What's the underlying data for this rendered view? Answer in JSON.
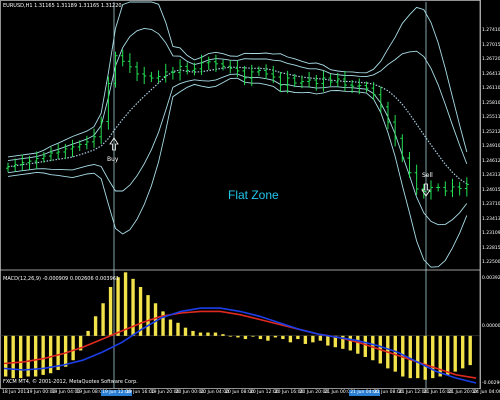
{
  "chart_header": "EURUSD,H1  1.31165 1.31189 1.31165 1.31220",
  "indicator_header": "MACD(12,26,9) -0.000909 0.002606 0.003961",
  "copyright": "FXCM MT4, © 2001-2012, MetaQuotes Software Corp.",
  "annotations": {
    "zone": "Flat Zone",
    "buy": "Buy",
    "sell": "Sell"
  },
  "price_axis": [
    "1.27410",
    "1.27015",
    "1.26720",
    "1.26413",
    "1.26110",
    "1.25810",
    "1.25511",
    "1.25212",
    "1.24910",
    "1.24612",
    "1.24313",
    "1.24015",
    "1.23710",
    "1.23413",
    "1.23109",
    "1.22815",
    "1.22500"
  ],
  "macd_axis": [
    "0.003920",
    "0.000000",
    "-0.002960"
  ],
  "time_axis": [
    {
      "t": "18 Jun 2013",
      "hl": false
    },
    {
      "t": "19 Jun 00:00",
      "hl": false
    },
    {
      "t": "19 Jun 04:00",
      "hl": false
    },
    {
      "t": "19 Jun 08:00",
      "hl": false
    },
    {
      "t": "19 Jun 12:00",
      "hl": true
    },
    {
      "t": "19 Jun 16:00",
      "hl": false
    },
    {
      "t": "19 Jun 20:00",
      "hl": false
    },
    {
      "t": "20 Jun 00:00",
      "hl": false
    },
    {
      "t": "20 Jun 04:00",
      "hl": false
    },
    {
      "t": "20 Jun 08:00",
      "hl": false
    },
    {
      "t": "20 Jun 12:00",
      "hl": false
    },
    {
      "t": "20 Jun 16:00",
      "hl": false
    },
    {
      "t": "20 Jun 20:00",
      "hl": false
    },
    {
      "t": "21 Jun 00:00",
      "hl": false
    },
    {
      "t": "21 Jun 04:00",
      "hl": true
    },
    {
      "t": "21 Jun 08:00",
      "hl": false
    },
    {
      "t": "21 Jun 12:00",
      "hl": false
    },
    {
      "t": "21 Jun 16:00",
      "hl": false
    },
    {
      "t": "21 Jun 20:00",
      "hl": false
    },
    {
      "t": "24 Jun 04:00",
      "hl": false
    }
  ],
  "colors": {
    "background": "#000000",
    "candle": "#22e052",
    "band": "#a8dce6",
    "ma": "#aacde0",
    "macd_hist": "#f3e34a",
    "macd_line": "#1b3ee6",
    "signal_line": "#e02a1f",
    "zone_text": "#22c7ee"
  },
  "chart_data": {
    "type": "candlestick",
    "price_range": [
      1.225,
      1.2775
    ],
    "close": [
      1.245,
      1.2454,
      1.2458,
      1.2461,
      1.2466,
      1.2471,
      1.2477,
      1.2479,
      1.2485,
      1.2489,
      1.2494,
      1.2499,
      1.2509,
      1.2539,
      1.2614,
      1.2669,
      1.2658,
      1.2647,
      1.2633,
      1.2629,
      1.2625,
      1.2628,
      1.2637,
      1.2636,
      1.2648,
      1.264,
      1.2643,
      1.2655,
      1.2657,
      1.2653,
      1.2648,
      1.2644,
      1.2639,
      1.2625,
      1.2637,
      1.264,
      1.2633,
      1.2627,
      1.2611,
      1.2625,
      1.2615,
      1.2618,
      1.2621,
      1.2614,
      1.2625,
      1.2617,
      1.2623,
      1.2611,
      1.2609,
      1.261,
      1.2605,
      1.2592,
      1.2568,
      1.2538,
      1.2506,
      1.2467,
      1.2438,
      1.2406,
      1.2401,
      1.2409,
      1.2409,
      1.2402,
      1.241,
      1.2407,
      1.2415
    ],
    "macd_hist": [
      -0.0025,
      -0.0026,
      -0.0026,
      -0.0025,
      -0.0025,
      -0.0024,
      -0.0023,
      -0.0021,
      -0.0019,
      -0.0015,
      -0.0009,
      0.0003,
      0.0012,
      0.002,
      0.003,
      0.0036,
      0.0039,
      0.0035,
      0.003,
      0.0025,
      0.002,
      0.0015,
      0.001,
      0.0008,
      0.0005,
      0.0003,
      0.0002,
      0.0002,
      0.0002,
      0.0001,
      0.0,
      -0.0001,
      -0.0002,
      0.0,
      -0.0002,
      -0.0003,
      -0.0001,
      -0.0002,
      -0.0004,
      -0.0002,
      -0.0005,
      -0.0004,
      -0.0003,
      -0.0006,
      -0.0007,
      -0.0008,
      -0.0009,
      -0.0011,
      -0.0013,
      -0.0015,
      -0.0017,
      -0.002,
      -0.0022,
      -0.0025,
      -0.0026,
      -0.0026,
      -0.0027,
      -0.0026,
      -0.0025,
      -0.0024,
      -0.0022,
      -0.002,
      -0.0018
    ],
    "macd_line": [
      -0.002,
      -0.0021,
      -0.002,
      -0.0018,
      -0.0015,
      -0.001,
      -0.0004,
      0.0004,
      0.0011,
      0.0015,
      0.0017,
      0.0017,
      0.0015,
      0.0012,
      0.0008,
      0.0004,
      0.0001,
      -0.0001,
      -0.0003,
      -0.0006,
      -0.001,
      -0.0016,
      -0.0022,
      -0.0026,
      -0.0029
    ],
    "signal_line": [
      -0.0017,
      -0.0016,
      -0.0014,
      -0.0011,
      -0.0007,
      -0.0002,
      0.0003,
      0.0008,
      0.0012,
      0.0014,
      0.0015,
      0.0015,
      0.0013,
      0.001,
      0.0007,
      0.0004,
      0.0001,
      -0.0001,
      -0.0004,
      -0.0008,
      -0.0012,
      -0.0016,
      -0.002,
      -0.0024,
      -0.0026
    ],
    "macd_range": [
      -0.00296,
      0.00392
    ]
  }
}
